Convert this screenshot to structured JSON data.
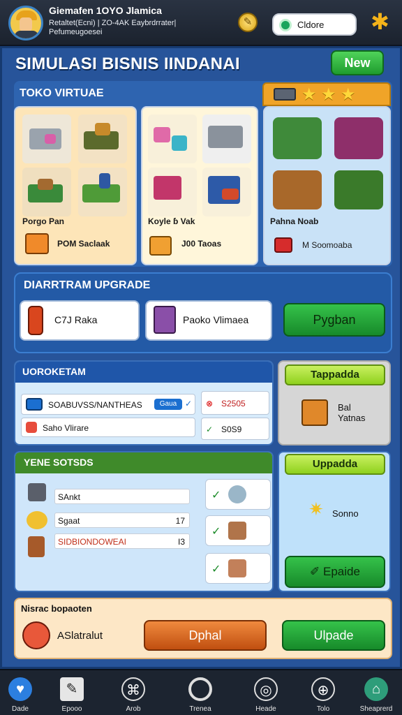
{
  "player": {
    "name": "Giemafen 1OYO Jlamica",
    "sub1": "Retaltet(Ecni) | ZO-4AK Eaybrdrrater|",
    "sub2": "Pefumeugoesei"
  },
  "header": {
    "search_text": "Cldore"
  },
  "title": "SIMULASI BISNIS IINDANAI",
  "new_button": "New",
  "toko": {
    "label": "TOKO VIRTUAE",
    "stars": 3,
    "products": [
      {
        "name": "Porgo Pan",
        "stat": "POM Saclaak"
      },
      {
        "name": "Koyle ɓ Vak",
        "stat": "J00 Taoas"
      },
      {
        "name": "Pahna Noab",
        "stat": "M Soomoaba"
      }
    ]
  },
  "upgrade": {
    "heading": "DIARRTRAM UPGRADE",
    "item1": "C7J Raka",
    "item2": "Paoko Vlimaea",
    "button": "Pygban"
  },
  "overview": {
    "heading": "UOROKETAM",
    "row1": "SOABUVSS/NANTHEAS",
    "row1_badge": "Gaua",
    "row2": "Saho Vlirare",
    "val1": "S2505",
    "val2": "S0S9",
    "side_button": "Tappadda",
    "side_text": "Bal Yatnas"
  },
  "stats": {
    "heading": "YENE SOTSDS",
    "rows": [
      {
        "label": "SAnkt",
        "value": ""
      },
      {
        "label": "Sgaat",
        "value": "17"
      },
      {
        "label": "SIDBIONDOWEAI",
        "value": "I3"
      }
    ],
    "side_button": "Uppadda",
    "side_text": "Sonno",
    "side_action": "Epaide"
  },
  "footer": {
    "heading": "Nisrac bopaoten",
    "item": "ASlatralut",
    "btn1": "Dphal",
    "btn2": "Ulpade"
  },
  "nav": [
    {
      "label": "Dade",
      "icon": "heart-icon"
    },
    {
      "label": "Epooo",
      "icon": "pencil-icon"
    },
    {
      "label": "Arob",
      "icon": "cart-icon"
    },
    {
      "label": "Trenea",
      "icon": "ring-icon"
    },
    {
      "label": "Heade",
      "icon": "globe-icon"
    },
    {
      "label": "Tolo",
      "icon": "lock-icon"
    },
    {
      "label": "Sheaprerd",
      "icon": "shop-icon"
    }
  ]
}
